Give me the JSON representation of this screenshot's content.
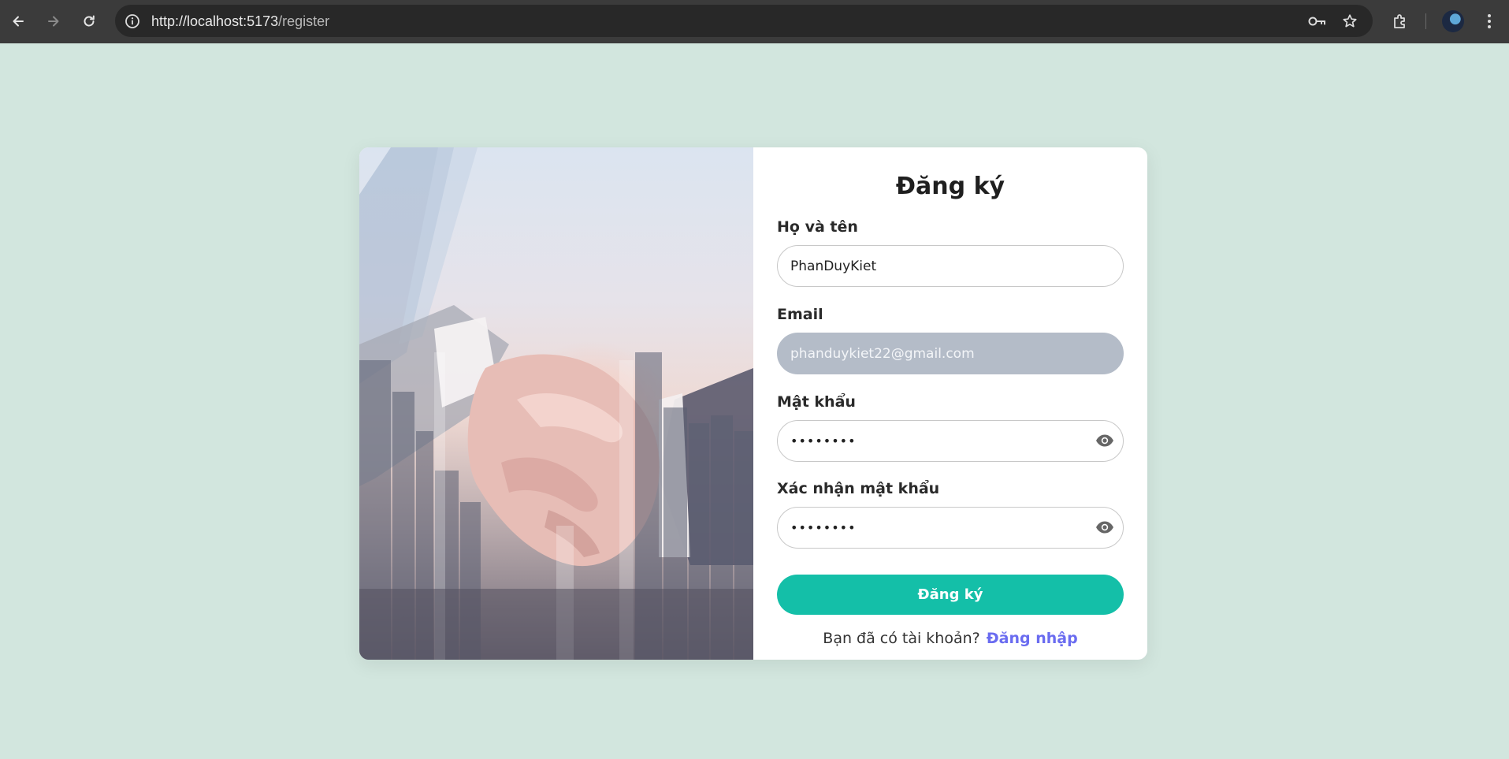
{
  "browser": {
    "url_host": "http://localhost:5173",
    "url_path": "/register"
  },
  "form": {
    "title": "Đăng ký",
    "fullname": {
      "label": "Họ và tên",
      "value": "PhanDuyKiet"
    },
    "email": {
      "label": "Email",
      "value": "phanduykiet22@gmail.com"
    },
    "password": {
      "label": "Mật khẩu",
      "value": "••••••••"
    },
    "confirm_password": {
      "label": "Xác nhận mật khẩu",
      "value": "••••••••"
    },
    "submit_label": "Đăng ký",
    "footer_text": "Bạn đã có tài khoản?",
    "login_link": "Đăng nhập"
  },
  "colors": {
    "page_background": "#d2e6de",
    "primary_button": "#14bfa8",
    "link": "#6a6cf0",
    "disabled_input": "#b4bcc8"
  },
  "icons": {
    "back": "arrow-left-icon",
    "forward": "arrow-right-icon",
    "reload": "reload-icon",
    "site_info": "info-icon",
    "password_manager": "key-icon",
    "bookmark": "star-icon",
    "extensions": "puzzle-icon",
    "menu": "kebab-menu-icon",
    "show_password": "eye-icon"
  }
}
